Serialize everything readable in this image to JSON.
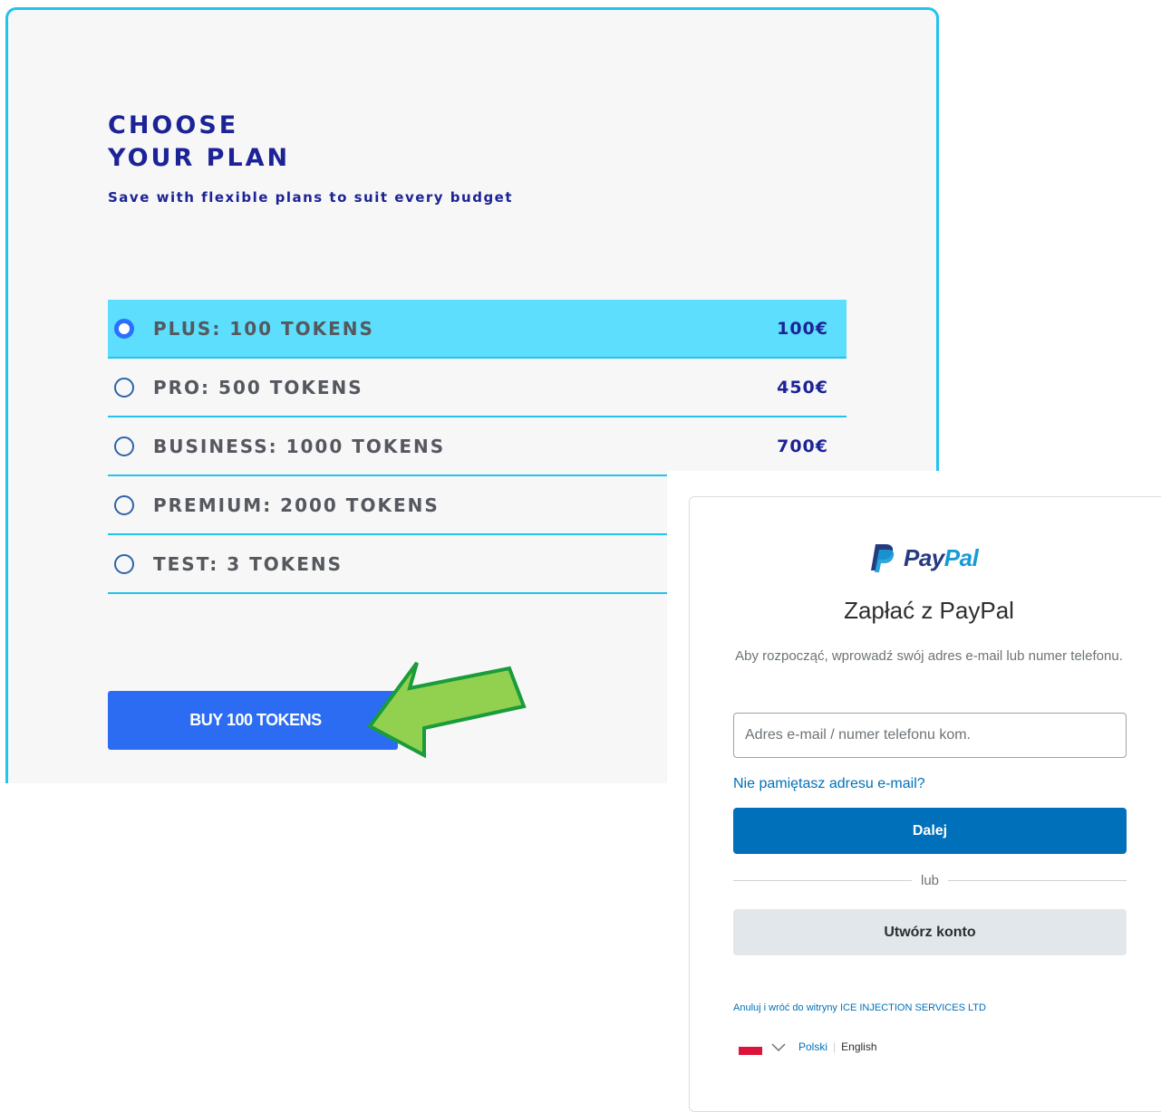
{
  "plan_card": {
    "title_line1": "CHOOSE",
    "title_line2": "YOUR PLAN",
    "subtitle": "Save with flexible plans to suit every budget",
    "plans": [
      {
        "name": "PLUS: 100 TOKENS",
        "price": "100€",
        "selected": true
      },
      {
        "name": "PRO: 500 TOKENS",
        "price": "450€",
        "selected": false
      },
      {
        "name": "BUSINESS: 1000 TOKENS",
        "price": "700€",
        "selected": false
      },
      {
        "name": "PREMIUM: 2000 TOKENS",
        "price": "",
        "selected": false
      },
      {
        "name": "TEST: 3 TOKENS",
        "price": "",
        "selected": false
      }
    ],
    "buy_label": "BUY 100 TOKENS"
  },
  "annotation": {
    "arrow_color": "#92d050",
    "arrow_outline": "#1a9c3a",
    "arrow_icon": "arrow-pointing-left-down-icon"
  },
  "paypal": {
    "logo_pay": "Pay",
    "logo_pal": "Pal",
    "heading": "Zapłać z PayPal",
    "intro": "Aby rozpocząć, wprowadź swój adres e-mail lub numer telefonu.",
    "email_placeholder": "Adres e-mail / numer telefonu kom.",
    "forgot_link": "Nie pamiętasz adresu e-mail?",
    "next_label": "Dalej",
    "or_label": "lub",
    "create_label": "Utwórz konto",
    "cancel_link": "Anuluj i wróć do witryny ICE INJECTION SERVICES LTD",
    "lang_polish": "Polski",
    "lang_english": "English"
  },
  "colors": {
    "accent_cyan": "#22c3ee",
    "selected_row": "#5cdefc",
    "title_navy": "#1c2396",
    "buy_blue": "#2b6cf3",
    "paypal_blue": "#0070ba"
  }
}
